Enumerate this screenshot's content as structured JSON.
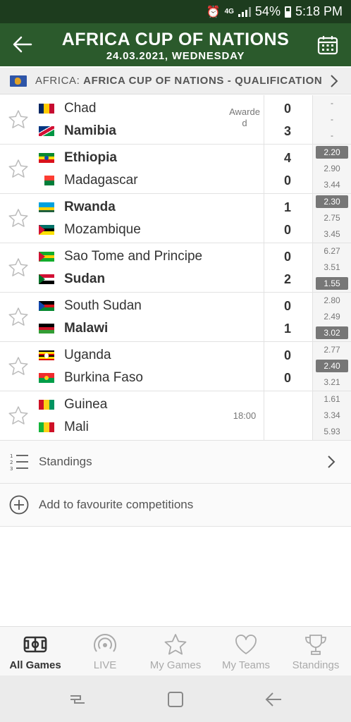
{
  "status_bar": {
    "network": "4G",
    "battery": "54%",
    "time": "5:18 PM"
  },
  "header": {
    "title": "AFRICA CUP OF NATIONS",
    "subtitle": "24.03.2021, WEDNESDAY"
  },
  "competition": {
    "region": "AFRICA:",
    "name": "AFRICA CUP OF NATIONS - QUALIFICATION"
  },
  "matches": [
    {
      "home": "Chad",
      "away": "Namibia",
      "home_score": "0",
      "away_score": "3",
      "status": "Awarded",
      "winner": "away",
      "odds": [
        "-",
        "-",
        "-"
      ],
      "highlight": null,
      "home_flag": "chad",
      "away_flag": "namibia"
    },
    {
      "home": "Ethiopia",
      "away": "Madagascar",
      "home_score": "4",
      "away_score": "0",
      "status": "",
      "winner": "home",
      "odds": [
        "2.20",
        "2.90",
        "3.44"
      ],
      "highlight": 0,
      "home_flag": "ethiopia",
      "away_flag": "madagascar"
    },
    {
      "home": "Rwanda",
      "away": "Mozambique",
      "home_score": "1",
      "away_score": "0",
      "status": "",
      "winner": "home",
      "odds": [
        "2.30",
        "2.75",
        "3.45"
      ],
      "highlight": 0,
      "home_flag": "rwanda",
      "away_flag": "mozambique"
    },
    {
      "home": "Sao Tome and Principe",
      "away": "Sudan",
      "home_score": "0",
      "away_score": "2",
      "status": "",
      "winner": "away",
      "odds": [
        "6.27",
        "3.51",
        "1.55"
      ],
      "highlight": 2,
      "home_flag": "sao-tome",
      "away_flag": "sudan"
    },
    {
      "home": "South Sudan",
      "away": "Malawi",
      "home_score": "0",
      "away_score": "1",
      "status": "",
      "winner": "away",
      "odds": [
        "2.80",
        "2.49",
        "3.02"
      ],
      "highlight": 2,
      "home_flag": "south-sudan",
      "away_flag": "malawi"
    },
    {
      "home": "Uganda",
      "away": "Burkina Faso",
      "home_score": "0",
      "away_score": "0",
      "status": "",
      "winner": "draw",
      "odds": [
        "2.77",
        "2.40",
        "3.21"
      ],
      "highlight": 1,
      "home_flag": "uganda",
      "away_flag": "burkina-faso"
    },
    {
      "home": "Guinea",
      "away": "Mali",
      "home_score": "",
      "away_score": "",
      "status": "18:00",
      "winner": "none",
      "odds": [
        "1.61",
        "3.34",
        "5.93"
      ],
      "highlight": null,
      "home_flag": "guinea",
      "away_flag": "mali"
    }
  ],
  "links": {
    "standings": "Standings",
    "add_favourite": "Add to favourite competitions"
  },
  "bottom_nav": [
    {
      "label": "All Games",
      "icon": "pitch-icon",
      "active": true
    },
    {
      "label": "LIVE",
      "icon": "live-icon",
      "active": false
    },
    {
      "label": "My Games",
      "icon": "star-icon",
      "active": false
    },
    {
      "label": "My Teams",
      "icon": "heart-icon",
      "active": false
    },
    {
      "label": "Standings",
      "icon": "trophy-icon",
      "active": false
    }
  ],
  "colors": {
    "header_bg": "#2b5a2c",
    "statusbar_bg": "#1d3c1e",
    "odds_highlight": "#777777"
  }
}
